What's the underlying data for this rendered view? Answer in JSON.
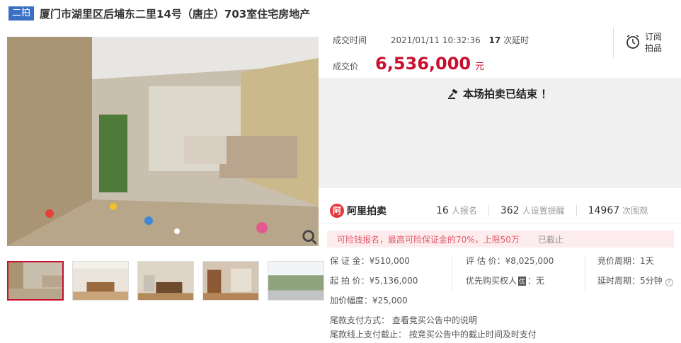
{
  "header": {
    "badge": "二拍",
    "title": "厦门市湖里区后埔东二里14号（唐庄）703室住宅房地产"
  },
  "deal": {
    "time_label": "成交时间",
    "time_value": "2021/01/11 10:32:36",
    "delays_count": "17",
    "delays_label": "次延时",
    "price_label": "成交价",
    "price": "6,536,000",
    "price_unit": "元"
  },
  "subscribe": {
    "label_line1": "订阅",
    "label_line2": "拍品"
  },
  "ended_message": "本场拍卖已结束 ！",
  "stats": {
    "brand": "阿里拍卖",
    "brand_logo": "阿",
    "signups": "16",
    "signups_label": "人报名",
    "reminders": "362",
    "reminders_label": "人设置提醒",
    "views": "14967",
    "views_label": "次围观"
  },
  "notice": {
    "text": "可险钱报名，最高可险保证金的70%，上限50万",
    "status": "已截止"
  },
  "details": {
    "deposit": "保 证 金：¥510,000",
    "start_price": "起 拍 价：¥5,136,000",
    "increment": "加价幅度：¥25,000",
    "appraisal": "评 估 价：¥8,025,000",
    "priority_prefix": "优先购买权人",
    "priority_tag": "优",
    "priority_value": "：无",
    "bid_period": "竞价周期：1天",
    "delay_period": "延时周期：5分钟",
    "help_icon": "?"
  },
  "payment": {
    "method": "尾款支付方式：  查看竞买公告中的说明",
    "deadline": "尾款线上支付截止：  按竞买公告中的截止时间及时支付"
  },
  "icons": {
    "zoom": "search-icon",
    "clock": "alarm-clock-icon",
    "gavel": "gavel-icon"
  }
}
